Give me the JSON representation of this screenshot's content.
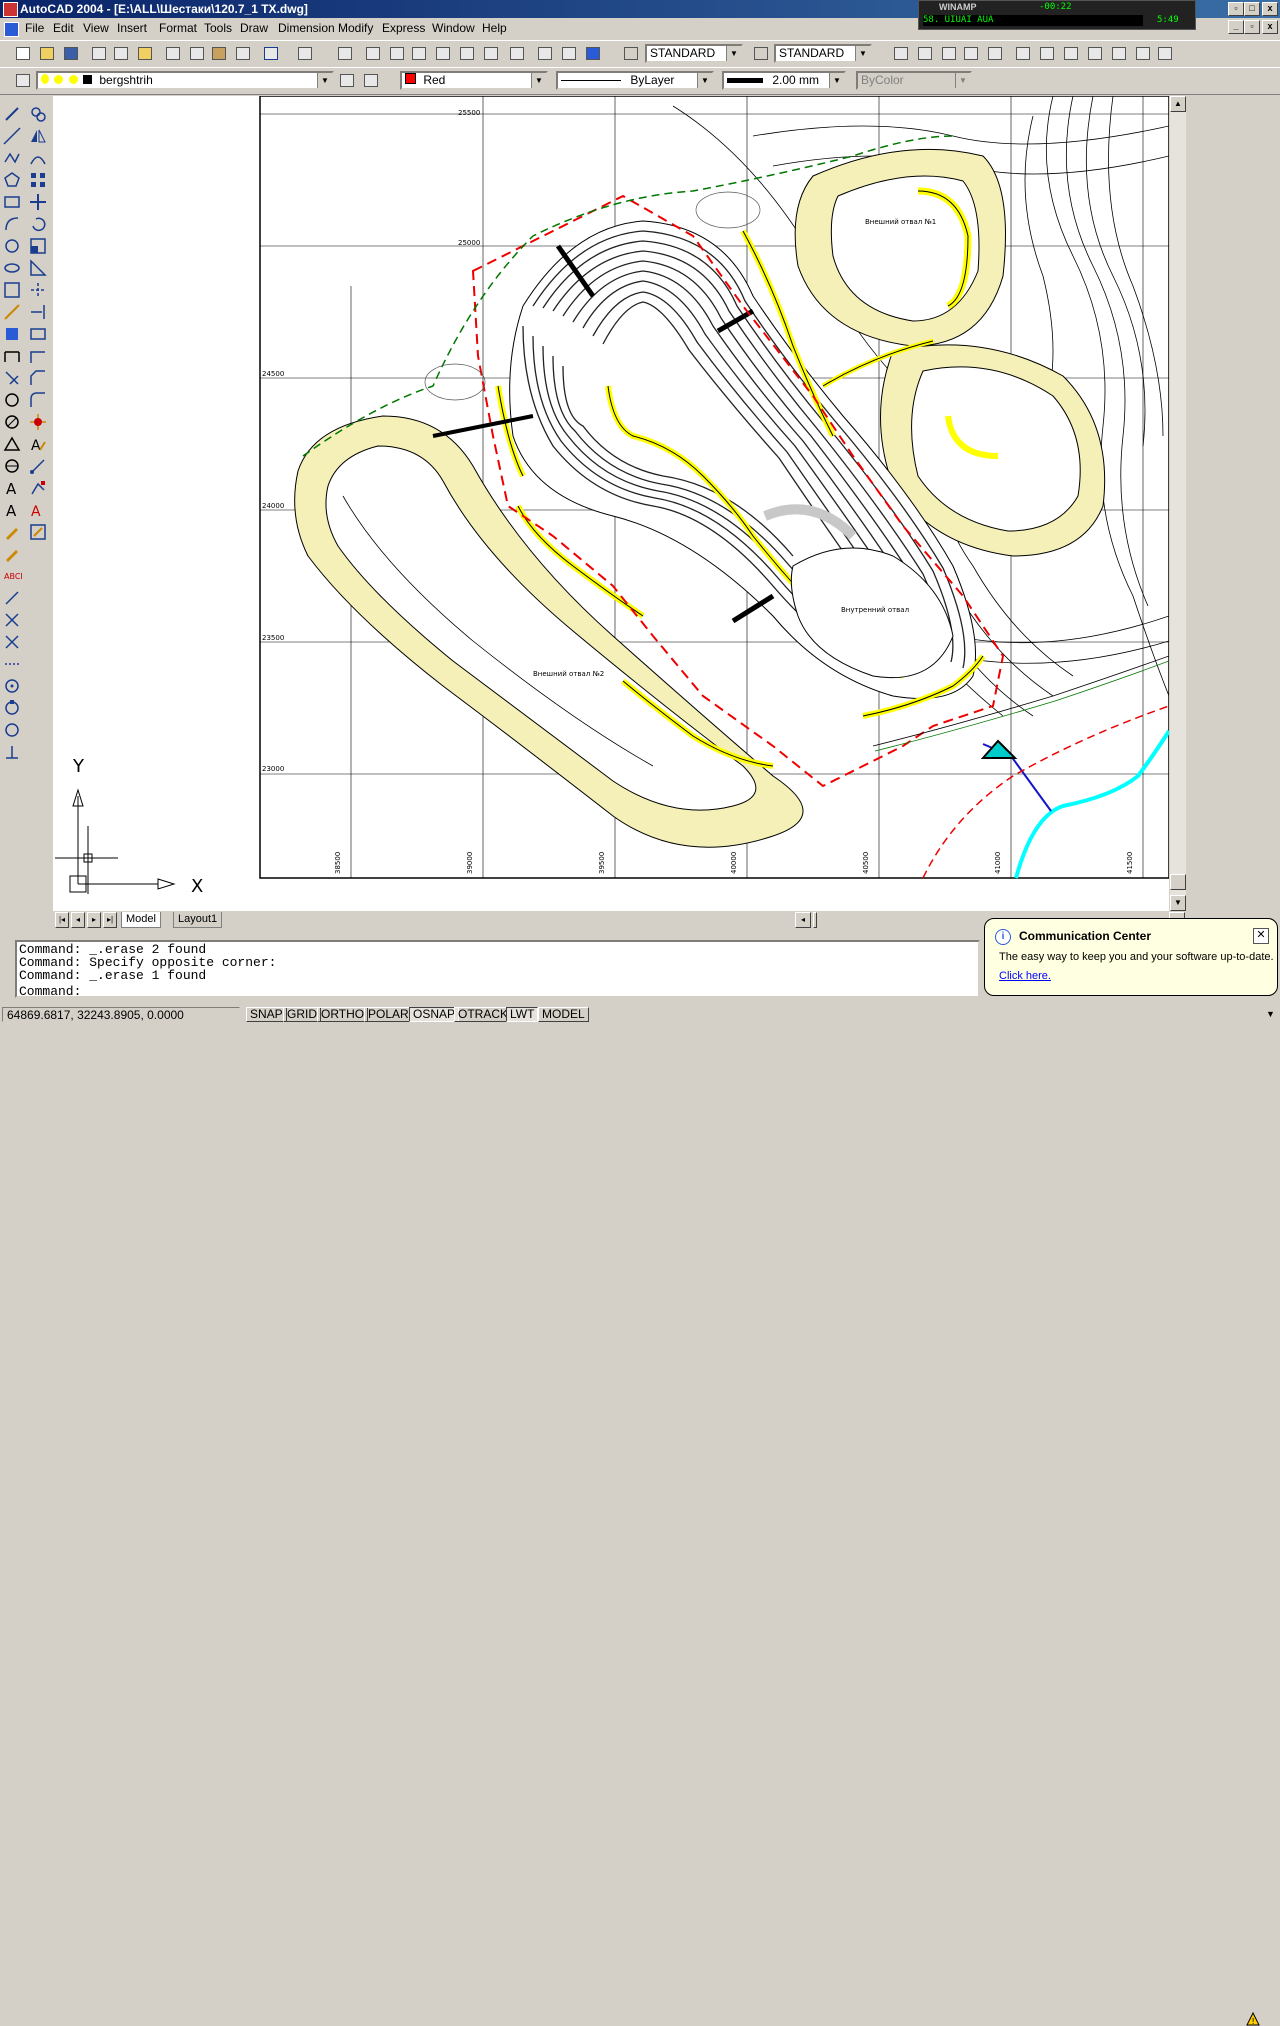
{
  "window": {
    "title": "AutoCAD 2004 - [E:\\ALL\\Шестаки\\120.7_1 ТХ.dwg]",
    "controls": [
      "_",
      "▫",
      "x"
    ]
  },
  "winamp": {
    "title": "WINAMP",
    "time": "-00:22",
    "track": "58.  UIUAI AUA",
    "clock": "5:49"
  },
  "menu": [
    "File",
    "Edit",
    "View",
    "Insert",
    "Format",
    "Tools",
    "Draw",
    "Dimension",
    "Modify",
    "Express",
    "Window",
    "Help"
  ],
  "toolbar": {
    "text_style": "STANDARD",
    "dim_style": "STANDARD"
  },
  "properties": {
    "layer": "bergshtrih",
    "color": "Red",
    "color_hex": "#ff0000",
    "linetype": "ByLayer",
    "lineweight": "2.00 mm",
    "plotstyle": "ByColor"
  },
  "drawing": {
    "grid_y_labels": [
      "25500",
      "25000",
      "24500",
      "24000",
      "23500",
      "23000"
    ],
    "grid_x_labels": [
      "38500",
      "39000",
      "39500",
      "40000",
      "40500",
      "41000",
      "41500"
    ],
    "labels": {
      "dump1": "Внешний отвал №1",
      "dump2": "Внешний отвал №2",
      "inner_dump": "Внутренний отвал"
    },
    "ucs": {
      "x": "X",
      "y": "Y"
    }
  },
  "tabs": [
    "Model",
    "Layout1"
  ],
  "command_history": [
    "Command: _.erase 2 found",
    "Command: Specify opposite corner:",
    "Command: _.erase 1 found",
    "Command:"
  ],
  "status": {
    "coords": "64869.6817, 32243.8905, 0.0000",
    "toggles": [
      {
        "label": "SNAP",
        "on": false
      },
      {
        "label": "GRID",
        "on": false
      },
      {
        "label": "ORTHO",
        "on": false
      },
      {
        "label": "POLAR",
        "on": false
      },
      {
        "label": "OSNAP",
        "on": true
      },
      {
        "label": "OTRACK",
        "on": false
      },
      {
        "label": "LWT",
        "on": true
      },
      {
        "label": "MODEL",
        "on": false
      }
    ]
  },
  "comm_center": {
    "title": "Communication Center",
    "text": "The easy way to keep you and your software up-to-date.",
    "link": "Click here."
  }
}
